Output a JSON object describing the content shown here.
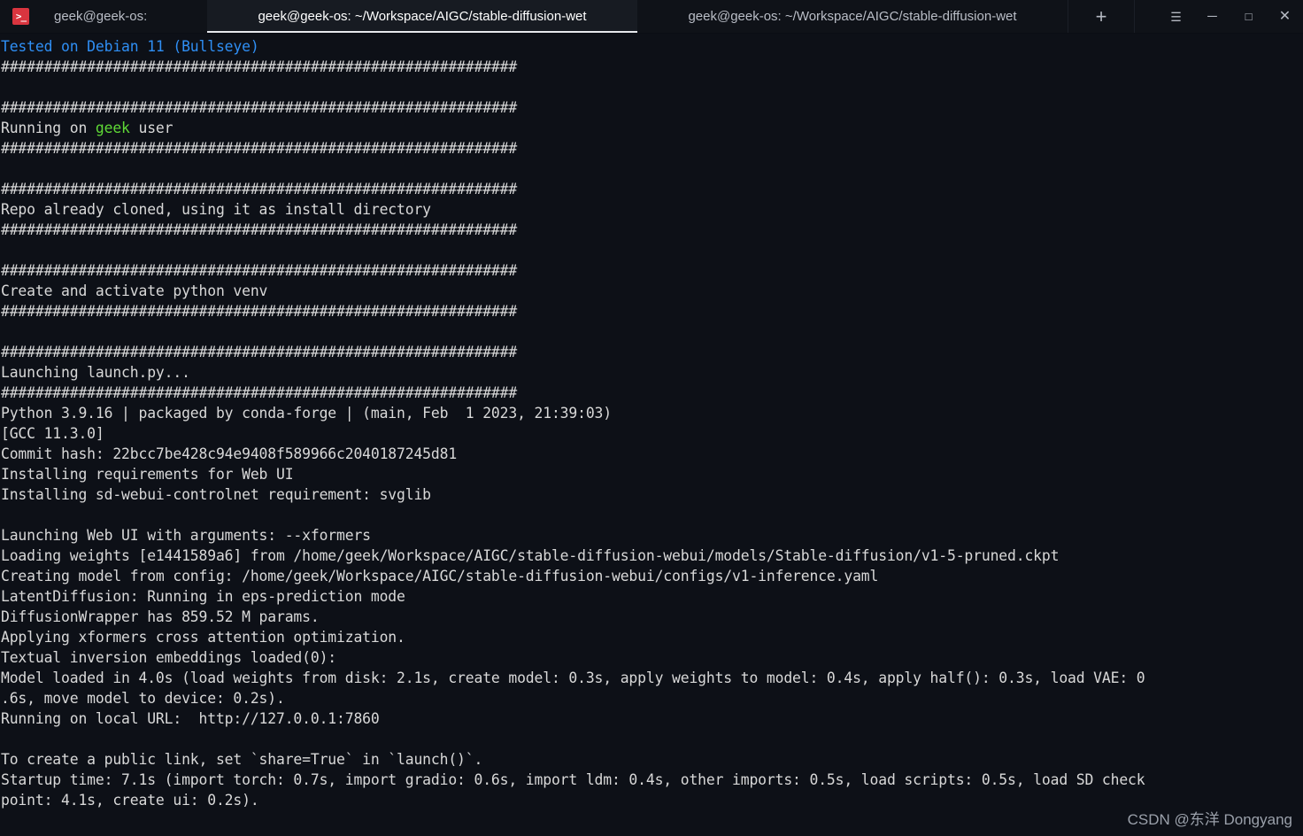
{
  "window": {
    "app_icon_glyph": ">_",
    "tabs": [
      {
        "label": "geek@geek-os: ",
        "active": false,
        "name": "tab-0"
      },
      {
        "label": "geek@geek-os: ~/Workspace/AIGC/stable-diffusion-wet",
        "active": true,
        "name": "tab-1"
      },
      {
        "label": "geek@geek-os: ~/Workspace/AIGC/stable-diffusion-wet",
        "active": false,
        "name": "tab-2"
      }
    ],
    "new_tab_label": "+",
    "controls": {
      "menu": "☰",
      "minimize": "─",
      "maximize": "□",
      "close": "✕"
    }
  },
  "colors": {
    "background": "#0d1017",
    "titlebar": "#0f1218",
    "active_tab": "#171b22",
    "foreground": "#d8d8d8",
    "blue": "#2f8ff5",
    "green": "#5fd936",
    "icon_red": "#d9353f"
  },
  "terminal": {
    "hash_rule": "############################################################",
    "lines": [
      {
        "segments": [
          {
            "text": "Tested on Debian 11 (Bullseye)",
            "color": "blue"
          }
        ]
      },
      {
        "segments": [
          {
            "text": "############################################################",
            "color": "white"
          }
        ]
      },
      {
        "segments": [
          {
            "text": "",
            "color": "white"
          }
        ]
      },
      {
        "segments": [
          {
            "text": "############################################################",
            "color": "white"
          }
        ]
      },
      {
        "segments": [
          {
            "text": "Running on ",
            "color": "white"
          },
          {
            "text": "geek",
            "color": "green"
          },
          {
            "text": " user",
            "color": "white"
          }
        ]
      },
      {
        "segments": [
          {
            "text": "############################################################",
            "color": "white"
          }
        ]
      },
      {
        "segments": [
          {
            "text": "",
            "color": "white"
          }
        ]
      },
      {
        "segments": [
          {
            "text": "############################################################",
            "color": "white"
          }
        ]
      },
      {
        "segments": [
          {
            "text": "Repo already cloned, using it as install directory",
            "color": "white"
          }
        ]
      },
      {
        "segments": [
          {
            "text": "############################################################",
            "color": "white"
          }
        ]
      },
      {
        "segments": [
          {
            "text": "",
            "color": "white"
          }
        ]
      },
      {
        "segments": [
          {
            "text": "############################################################",
            "color": "white"
          }
        ]
      },
      {
        "segments": [
          {
            "text": "Create and activate python venv",
            "color": "white"
          }
        ]
      },
      {
        "segments": [
          {
            "text": "############################################################",
            "color": "white"
          }
        ]
      },
      {
        "segments": [
          {
            "text": "",
            "color": "white"
          }
        ]
      },
      {
        "segments": [
          {
            "text": "############################################################",
            "color": "white"
          }
        ]
      },
      {
        "segments": [
          {
            "text": "Launching launch.py...",
            "color": "white"
          }
        ]
      },
      {
        "segments": [
          {
            "text": "############################################################",
            "color": "white"
          }
        ]
      },
      {
        "segments": [
          {
            "text": "Python 3.9.16 | packaged by conda-forge | (main, Feb  1 2023, 21:39:03)",
            "color": "white"
          }
        ]
      },
      {
        "segments": [
          {
            "text": "[GCC 11.3.0]",
            "color": "white"
          }
        ]
      },
      {
        "segments": [
          {
            "text": "Commit hash: 22bcc7be428c94e9408f589966c2040187245d81",
            "color": "white"
          }
        ]
      },
      {
        "segments": [
          {
            "text": "Installing requirements for Web UI",
            "color": "white"
          }
        ]
      },
      {
        "segments": [
          {
            "text": "Installing sd-webui-controlnet requirement: svglib",
            "color": "white"
          }
        ]
      },
      {
        "segments": [
          {
            "text": "",
            "color": "white"
          }
        ]
      },
      {
        "segments": [
          {
            "text": "Launching Web UI with arguments: --xformers",
            "color": "white"
          }
        ]
      },
      {
        "segments": [
          {
            "text": "Loading weights [e1441589a6] from /home/geek/Workspace/AIGC/stable-diffusion-webui/models/Stable-diffusion/v1-5-pruned.ckpt",
            "color": "white"
          }
        ]
      },
      {
        "segments": [
          {
            "text": "Creating model from config: /home/geek/Workspace/AIGC/stable-diffusion-webui/configs/v1-inference.yaml",
            "color": "white"
          }
        ]
      },
      {
        "segments": [
          {
            "text": "LatentDiffusion: Running in eps-prediction mode",
            "color": "white"
          }
        ]
      },
      {
        "segments": [
          {
            "text": "DiffusionWrapper has 859.52 M params.",
            "color": "white"
          }
        ]
      },
      {
        "segments": [
          {
            "text": "Applying xformers cross attention optimization.",
            "color": "white"
          }
        ]
      },
      {
        "segments": [
          {
            "text": "Textual inversion embeddings loaded(0):",
            "color": "white"
          }
        ]
      },
      {
        "segments": [
          {
            "text": "Model loaded in 4.0s (load weights from disk: 2.1s, create model: 0.3s, apply weights to model: 0.4s, apply half(): 0.3s, load VAE: 0",
            "color": "white"
          }
        ]
      },
      {
        "segments": [
          {
            "text": ".6s, move model to device: 0.2s).",
            "color": "white"
          }
        ]
      },
      {
        "segments": [
          {
            "text": "Running on local URL:  http://127.0.0.1:7860",
            "color": "white"
          }
        ]
      },
      {
        "segments": [
          {
            "text": "",
            "color": "white"
          }
        ]
      },
      {
        "segments": [
          {
            "text": "To create a public link, set `share=True` in `launch()`.",
            "color": "white"
          }
        ]
      },
      {
        "segments": [
          {
            "text": "Startup time: 7.1s (import torch: 0.7s, import gradio: 0.6s, import ldm: 0.4s, other imports: 0.5s, load scripts: 0.5s, load SD check",
            "color": "white"
          }
        ]
      },
      {
        "segments": [
          {
            "text": "point: 4.1s, create ui: 0.2s).",
            "color": "white"
          }
        ]
      }
    ]
  },
  "watermark": {
    "text": "CSDN @东洋 Dongyang"
  }
}
